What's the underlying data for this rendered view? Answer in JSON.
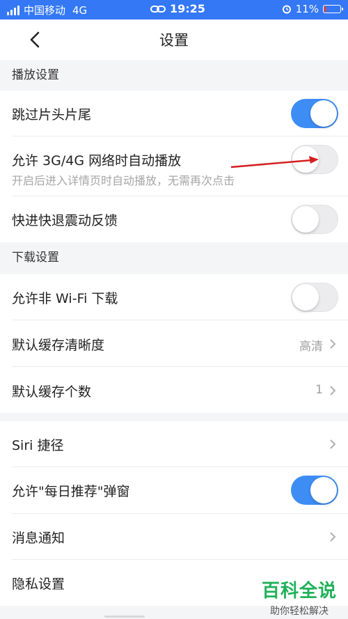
{
  "status_bar": {
    "carrier": "中国移动",
    "network": "4G",
    "time": "19:25",
    "battery": "11%",
    "battery_color": "#ff3b30",
    "background": "#3478f6"
  },
  "nav": {
    "title": "设置"
  },
  "sections": {
    "playback": {
      "header": "播放设置"
    },
    "download": {
      "header": "下载设置"
    }
  },
  "rows": {
    "skip_intro": {
      "label": "跳过片头片尾",
      "toggle": "on"
    },
    "autoplay_mobile": {
      "label": "允许 3G/4G 网络时自动播放",
      "sub": "开启后进入详情页时自动播放，无需再次点击",
      "toggle": "off"
    },
    "haptic": {
      "label": "快进快退震动反馈",
      "toggle": "off"
    },
    "non_wifi_download": {
      "label": "允许非 Wi-Fi 下载",
      "toggle": "off"
    },
    "cache_quality": {
      "label": "默认缓存清晰度",
      "value": "高清"
    },
    "cache_count": {
      "label": "默认缓存个数",
      "value": "1"
    },
    "siri": {
      "label": "Siri 捷径"
    },
    "daily_popup": {
      "label": "允许\"每日推荐\"弹窗",
      "toggle": "on"
    },
    "notifications": {
      "label": "消息通知"
    },
    "privacy": {
      "label": "隐私设置"
    }
  },
  "watermark": {
    "title": "百科全说",
    "subtitle": "助你轻松解决"
  },
  "colors": {
    "accent": "#3e8df5",
    "annotation_arrow": "#d42020",
    "watermark": "#20b15a"
  }
}
